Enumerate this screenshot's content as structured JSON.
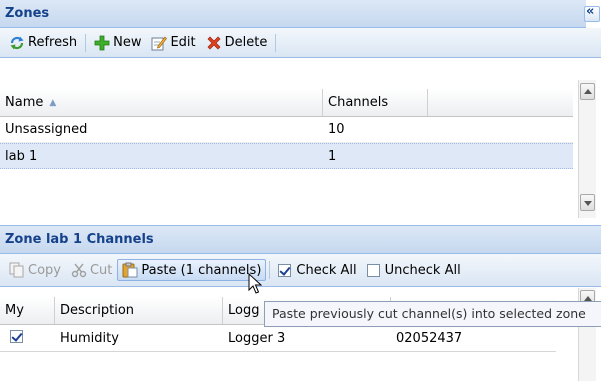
{
  "zones_panel": {
    "title": "Zones",
    "collapse_icon": "double-chevron-left-icon",
    "toolbar": {
      "refresh_label": "Refresh",
      "new_label": "New",
      "edit_label": "Edit",
      "delete_label": "Delete"
    },
    "grid": {
      "columns": [
        "Name",
        "Channels"
      ],
      "sort_indicator": "▲",
      "rows": [
        {
          "name": "Unsassigned",
          "channels": "10"
        },
        {
          "name": "lab 1",
          "channels": "1"
        }
      ]
    }
  },
  "channels_panel": {
    "title": "Zone lab 1 Channels",
    "toolbar": {
      "copy_label": "Copy",
      "cut_label": "Cut",
      "paste_label": "Paste (1 channels)",
      "check_all_label": "Check All",
      "uncheck_all_label": "Uncheck All"
    },
    "grid": {
      "columns": [
        "My",
        "Description",
        "Logg"
      ],
      "rows": [
        {
          "my": true,
          "description": "Humidity",
          "logger": "Logger 3",
          "serial": "02052437"
        }
      ]
    }
  },
  "tooltip": {
    "text": "Paste previously cut channel(s) into selected zone"
  },
  "colors": {
    "header_text": "#15428b",
    "selected_row": "#dfe8f6",
    "border": "#99bbe8"
  }
}
